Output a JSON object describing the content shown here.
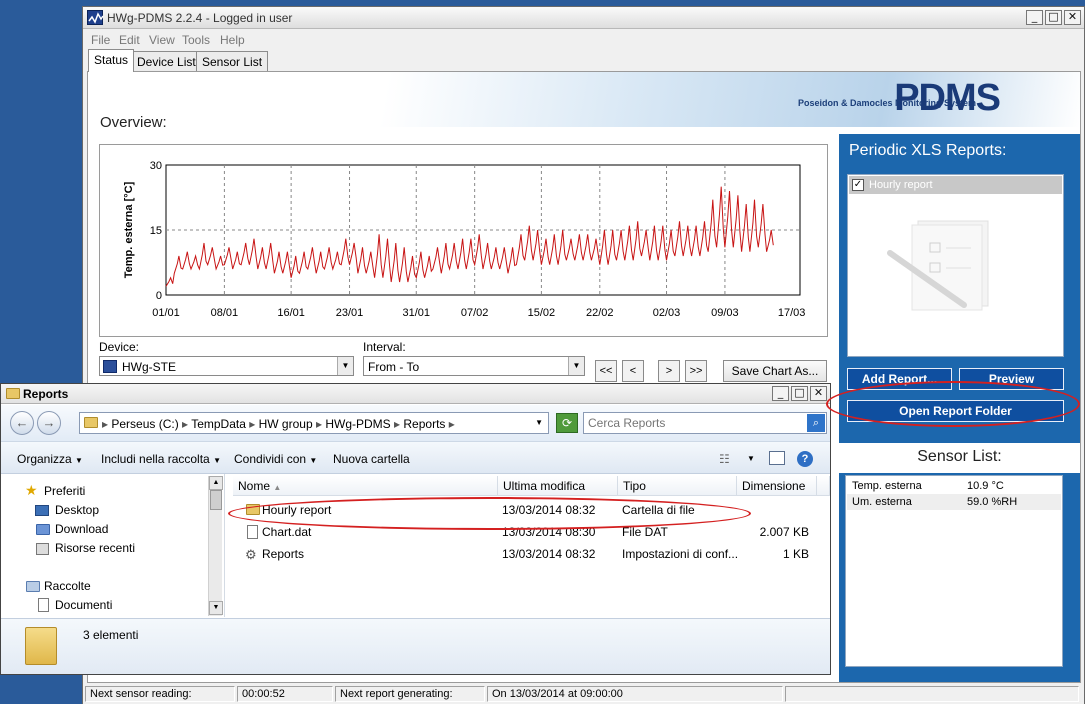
{
  "pdms": {
    "title": "HWg-PDMS 2.2.4 - Logged in user",
    "menu": [
      "File",
      "Edit",
      "View",
      "Tools",
      "Help"
    ],
    "tabs": [
      "Status",
      "Device List",
      "Sensor List"
    ],
    "banner_subtitle": "Poseidon & Damocles Monitoring System",
    "banner_logo": "PDMS",
    "overview_label": "Overview:",
    "device_label": "Device:",
    "device_value": "HWg-STE",
    "interval_label": "Interval:",
    "interval_value": "From - To",
    "nav_buttons": [
      "<<",
      "<",
      ">",
      ">>"
    ],
    "save_chart_label": "Save Chart As...",
    "right_panel": {
      "reports_heading": "Periodic XLS Reports:",
      "report_item": "Hourly report",
      "add_report_label": "Add Report...",
      "preview_label": "Preview",
      "open_folder_label": "Open Report Folder",
      "sensor_heading": "Sensor List:",
      "sensors": [
        {
          "name": "Temp. esterna",
          "value": "10.9 °C"
        },
        {
          "name": "Um. esterna",
          "value": "59.0 %RH"
        }
      ]
    },
    "statusbar": {
      "next_reading_label": "Next sensor reading:",
      "next_reading_value": "00:00:52",
      "next_report_label": "Next report generating:",
      "next_report_value": "On 13/03/2014 at 09:00:00"
    }
  },
  "chart_data": {
    "type": "line",
    "title": "",
    "ylabel": "Temp. esterna [°C]",
    "xlabel": "",
    "ylim": [
      0,
      30
    ],
    "yticks": [
      0,
      15,
      30
    ],
    "x_ticks": [
      "01/01",
      "08/01",
      "16/01",
      "23/01",
      "31/01",
      "07/02",
      "15/02",
      "22/02",
      "02/03",
      "09/03",
      "17/03"
    ],
    "grid": true,
    "series": [
      {
        "color": "#c81414",
        "x_days": [
          0,
          1,
          2,
          3,
          4,
          5,
          6,
          7,
          8,
          9,
          10,
          11,
          12,
          13,
          14,
          15,
          16,
          17,
          18,
          19,
          20,
          21,
          22,
          23,
          24,
          25,
          26,
          27,
          28,
          29,
          30,
          31,
          32,
          33,
          34,
          35,
          36,
          37,
          38,
          39,
          40,
          41,
          42,
          43,
          44,
          45,
          46,
          47,
          48,
          49,
          50,
          51,
          52,
          53,
          54,
          55,
          56,
          57,
          58,
          59,
          60,
          61,
          62,
          63,
          64,
          65,
          66,
          67,
          68,
          69,
          70,
          71,
          72
        ],
        "daily_low": [
          2,
          5,
          6,
          6,
          6,
          7,
          6,
          7,
          6,
          7,
          7,
          6,
          6,
          5,
          5,
          4,
          5,
          6,
          5,
          6,
          6,
          7,
          7,
          5,
          5,
          4,
          4,
          3,
          3,
          3,
          4,
          4,
          6,
          5,
          6,
          6,
          6,
          7,
          6,
          6,
          6,
          5,
          7,
          8,
          8,
          7,
          7,
          7,
          8,
          8,
          8,
          8,
          7,
          7,
          8,
          8,
          8,
          9,
          8,
          8,
          8,
          9,
          9,
          9,
          9,
          10,
          11,
          11,
          11,
          10,
          10,
          11,
          10
        ],
        "daily_high": [
          4,
          9,
          10,
          9,
          12,
          11,
          9,
          11,
          10,
          12,
          13,
          11,
          12,
          10,
          10,
          9,
          10,
          11,
          10,
          11,
          10,
          13,
          12,
          11,
          10,
          14,
          13,
          12,
          11,
          9,
          10,
          9,
          11,
          12,
          12,
          13,
          13,
          14,
          12,
          11,
          11,
          11,
          14,
          16,
          15,
          13,
          14,
          15,
          13,
          14,
          14,
          13,
          15,
          15,
          15,
          16,
          17,
          15,
          16,
          16,
          15,
          17,
          16,
          16,
          17,
          22,
          25,
          24,
          23,
          21,
          22,
          21,
          15
        ]
      }
    ]
  },
  "explorer": {
    "title": "Reports",
    "breadcrumb": [
      "Perseus (C:)",
      "TempData",
      "HW group",
      "HWg-PDMS",
      "Reports"
    ],
    "search_placeholder": "Cerca Reports",
    "toolbar": [
      "Organizza",
      "Includi nella raccolta",
      "Condividi con",
      "Nuova cartella"
    ],
    "nav": {
      "favorites": "Preferiti",
      "items": [
        "Desktop",
        "Download",
        "Risorse recenti"
      ],
      "libraries": "Raccolte",
      "lib_items": [
        "Documenti"
      ]
    },
    "columns": [
      "Nome",
      "Ultima modifica",
      "Tipo",
      "Dimensione"
    ],
    "files": [
      {
        "name": "Hourly report",
        "modified": "13/03/2014 08:32",
        "type": "Cartella di file",
        "size": ""
      },
      {
        "name": "Chart.dat",
        "modified": "13/03/2014 08:30",
        "type": "File DAT",
        "size": "2.007 KB"
      },
      {
        "name": "Reports",
        "modified": "13/03/2014 08:32",
        "type": "Impostazioni di conf...",
        "size": "1 KB"
      }
    ],
    "item_count": "3 elementi"
  }
}
